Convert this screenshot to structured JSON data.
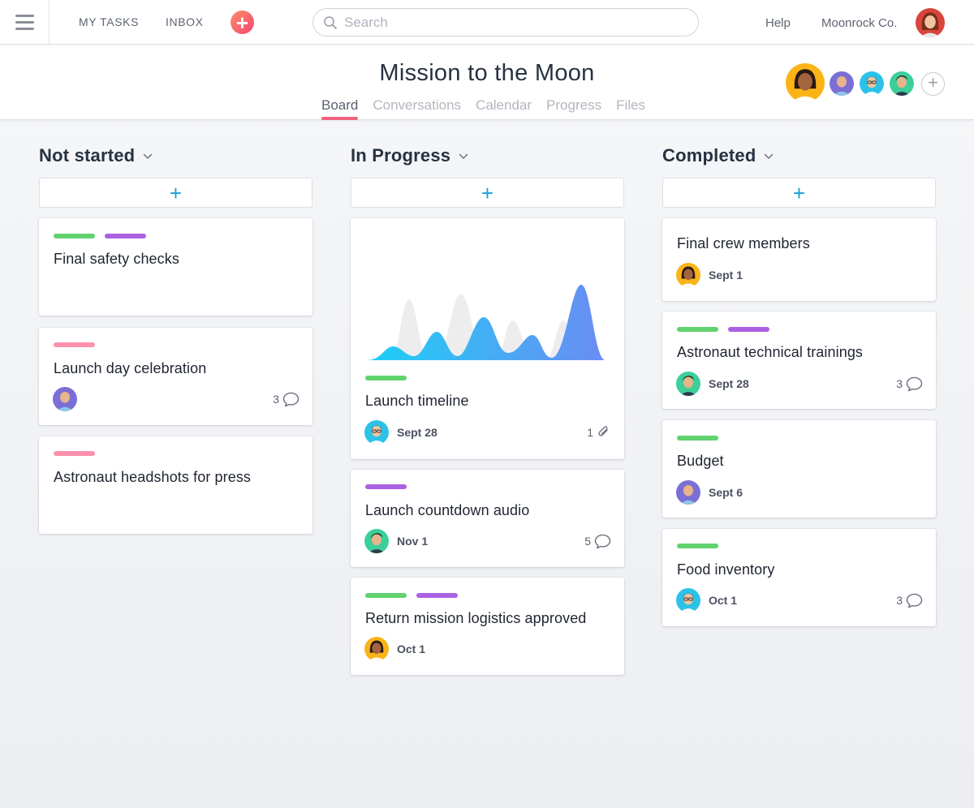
{
  "topbar": {
    "my_tasks": "MY TASKS",
    "inbox": "INBOX",
    "add": "+",
    "search_placeholder": "Search",
    "help": "Help",
    "workspace": "Moonrock Co."
  },
  "project": {
    "title": "Mission to the Moon",
    "tabs": [
      "Board",
      "Conversations",
      "Calendar",
      "Progress",
      "Files"
    ],
    "active_tab": "Board",
    "add_member": "+"
  },
  "colors": {
    "green": "#62d26f",
    "purple": "#aa62e3",
    "pink": "#fc91ad",
    "accent_blue": "#18a0d8",
    "tab_underline": "#f0647e"
  },
  "columns": [
    {
      "title": "Not started",
      "add": "+",
      "cards": [
        {
          "tags": [
            "green",
            "purple"
          ],
          "title": "Final safety checks"
        },
        {
          "tags": [
            "pink"
          ],
          "title": "Launch day celebration",
          "comments": "3"
        },
        {
          "tags": [
            "pink"
          ],
          "title": "Astronaut headshots for press"
        }
      ]
    },
    {
      "title": "In Progress",
      "add": "+",
      "cards": [
        {
          "tags": [
            "green"
          ],
          "title": "Launch timeline",
          "due": "Sept 28",
          "attachments": "1"
        },
        {
          "tags": [
            "purple"
          ],
          "title": "Launch countdown audio",
          "due": "Nov 1",
          "comments": "5"
        },
        {
          "tags": [
            "green",
            "purple"
          ],
          "title": "Return mission logistics approved",
          "due": "Oct 1"
        }
      ]
    },
    {
      "title": "Completed",
      "add": "+",
      "cards": [
        {
          "title": "Final crew members",
          "due": "Sept 1"
        },
        {
          "tags": [
            "green",
            "purple"
          ],
          "title": "Astronaut technical trainings",
          "due": "Sept 28",
          "comments": "3"
        },
        {
          "tags": [
            "green"
          ],
          "title": "Budget",
          "due": "Sept 6"
        },
        {
          "tags": [
            "green"
          ],
          "title": "Food inventory",
          "due": "Oct 1",
          "comments": "3"
        }
      ]
    }
  ],
  "icons": {
    "menu": "hamburger-icon",
    "search": "search-icon",
    "chevron": "chevron-down-icon",
    "comment": "comment-icon",
    "attachment": "paperclip-icon"
  }
}
